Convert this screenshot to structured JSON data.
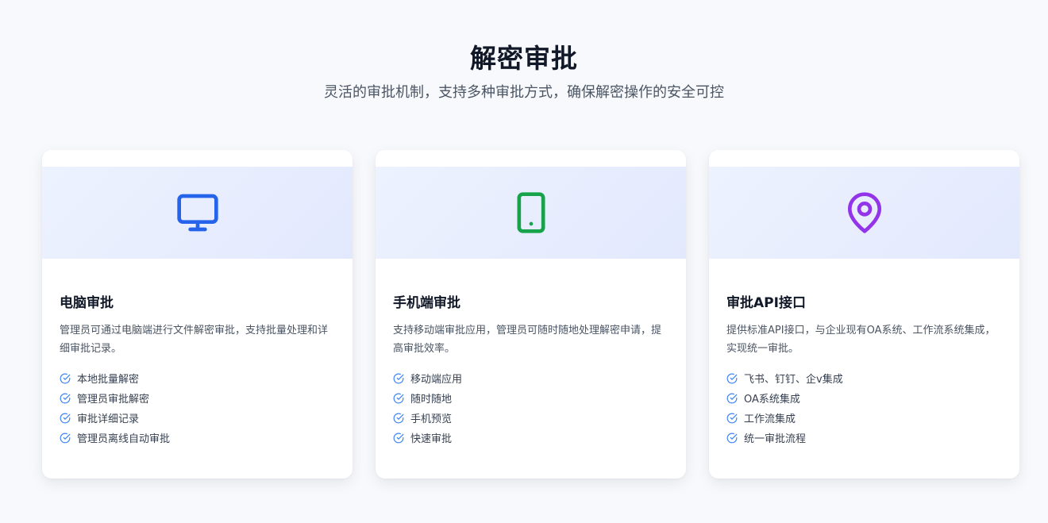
{
  "header": {
    "title": "解密审批",
    "subtitle": "灵活的审批机制，支持多种审批方式，确保解密操作的安全可控"
  },
  "colors": {
    "blue_icon": "#2563eb",
    "green_icon": "#16a34a",
    "purple_icon": "#9333ea",
    "check_icon": "#3b82f6"
  },
  "cards": [
    {
      "icon": "monitor-icon",
      "title": "电脑审批",
      "description": "管理员可通过电脑端进行文件解密审批，支持批量处理和详细审批记录。",
      "features": [
        "本地批量解密",
        "管理员审批解密",
        "审批详细记录",
        "管理员离线自动审批"
      ]
    },
    {
      "icon": "tablet-icon",
      "title": "手机端审批",
      "description": "支持移动端审批应用，管理员可随时随地处理解密申请，提高审批效率。",
      "features": [
        "移动端应用",
        "随时随地",
        "手机预览",
        "快速审批"
      ]
    },
    {
      "icon": "map-pin-icon",
      "title": "审批API接口",
      "description": "提供标准API接口，与企业现有OA系统、工作流系统集成，实现统一审批。",
      "features": [
        "飞书、钉钉、企v集成",
        "OA系统集成",
        "工作流集成",
        "统一审批流程"
      ]
    }
  ]
}
